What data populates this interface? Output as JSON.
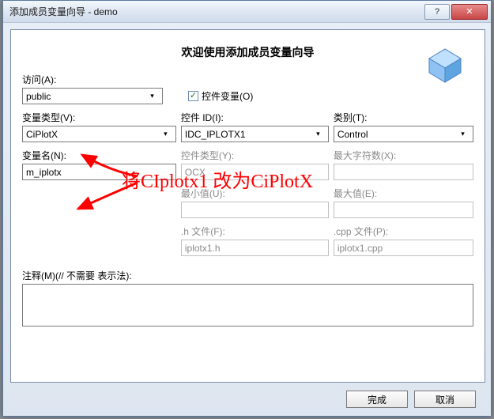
{
  "window": {
    "title": "添加成员变量向导 - demo"
  },
  "hero": {
    "heading": "欢迎使用添加成员变量向导"
  },
  "labels": {
    "access": "访问(A):",
    "control_var": "控件变量(O)",
    "var_type": "变量类型(V):",
    "control_id": "控件 ID(I):",
    "class_type": "类别(T):",
    "var_name": "变量名(N):",
    "control_type": "控件类型(Y):",
    "max_chars": "最大字符数(X):",
    "min_val": "最小值(U):",
    "max_val": "最大值(E):",
    "h_file": ".h 文件(F):",
    "cpp_file": ".cpp 文件(P):",
    "comment": "注释(M)(// 不需要 表示法):"
  },
  "values": {
    "access": "public",
    "var_type": "CiPlotX",
    "control_id": "IDC_IPLOTX1",
    "class_type": "Control",
    "var_name": "m_iplotx",
    "control_type": "OCX",
    "h_file": "iplotx1.h",
    "cpp_file": "iplotx1.cpp"
  },
  "annotation": {
    "text": "将CIplotx1 改为CiPlotX"
  },
  "buttons": {
    "finish": "完成",
    "cancel": "取消"
  },
  "titlebar_icons": {
    "help": "?",
    "close": "✕"
  },
  "checkbox": {
    "checked_glyph": "✓"
  }
}
